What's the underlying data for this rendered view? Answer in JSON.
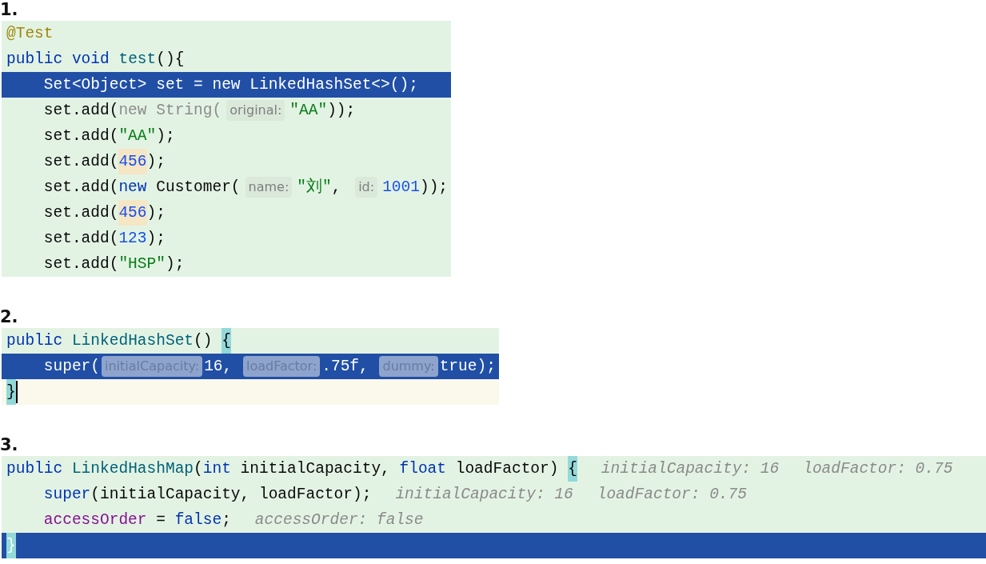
{
  "sections": [
    {
      "number": "1.",
      "lines": [
        {
          "selected": false,
          "caret": false,
          "indented": false,
          "tokens": [
            {
              "kind": "annotation",
              "text": "@Test"
            }
          ]
        },
        {
          "selected": false,
          "caret": false,
          "indented": false,
          "tokens": [
            {
              "kind": "keyword",
              "text": "public void "
            },
            {
              "kind": "method",
              "text": "test"
            },
            {
              "kind": "plain",
              "text": "(){"
            }
          ]
        },
        {
          "selected": true,
          "caret": false,
          "indented": true,
          "tokens": [
            {
              "kind": "plain",
              "text": "Set<Object> set = "
            },
            {
              "kind": "keyword",
              "text": "new"
            },
            {
              "kind": "plain",
              "text": " LinkedHashSet<>();"
            }
          ]
        },
        {
          "selected": false,
          "caret": false,
          "indented": true,
          "tokens": [
            {
              "kind": "plain",
              "text": "set.add("
            },
            {
              "kind": "muted",
              "text": "new String("
            },
            {
              "kind": "hint",
              "text": "original:"
            },
            {
              "kind": "string",
              "text": "\"AA\""
            },
            {
              "kind": "plain",
              "text": "));"
            }
          ]
        },
        {
          "selected": false,
          "caret": false,
          "indented": true,
          "tokens": [
            {
              "kind": "plain",
              "text": "set.add("
            },
            {
              "kind": "string",
              "text": "\"AA\""
            },
            {
              "kind": "plain",
              "text": ");"
            }
          ]
        },
        {
          "selected": false,
          "caret": false,
          "indented": true,
          "tokens": [
            {
              "kind": "plain",
              "text": "set.add("
            },
            {
              "kind": "occurrence",
              "text": "456"
            },
            {
              "kind": "plain",
              "text": ");"
            }
          ]
        },
        {
          "selected": false,
          "caret": false,
          "indented": true,
          "tokens": [
            {
              "kind": "plain",
              "text": "set.add("
            },
            {
              "kind": "keyword",
              "text": "new"
            },
            {
              "kind": "plain",
              "text": " Customer("
            },
            {
              "kind": "hint",
              "text": "name:"
            },
            {
              "kind": "string",
              "text": "\"刘\""
            },
            {
              "kind": "plain",
              "text": ", "
            },
            {
              "kind": "hint",
              "text": "id:"
            },
            {
              "kind": "number",
              "text": "1001"
            },
            {
              "kind": "plain",
              "text": "));"
            }
          ]
        },
        {
          "selected": false,
          "caret": false,
          "indented": true,
          "tokens": [
            {
              "kind": "plain",
              "text": "set.add("
            },
            {
              "kind": "occurrence",
              "text": "456"
            },
            {
              "kind": "plain",
              "text": ");"
            }
          ]
        },
        {
          "selected": false,
          "caret": false,
          "indented": true,
          "tokens": [
            {
              "kind": "plain",
              "text": "set.add("
            },
            {
              "kind": "number",
              "text": "123"
            },
            {
              "kind": "plain",
              "text": ");"
            }
          ]
        },
        {
          "selected": false,
          "caret": false,
          "indented": true,
          "tokens": [
            {
              "kind": "plain",
              "text": "set.add("
            },
            {
              "kind": "string",
              "text": "\"HSP\""
            },
            {
              "kind": "plain",
              "text": ");"
            }
          ]
        }
      ]
    },
    {
      "number": "2.",
      "lines": [
        {
          "selected": false,
          "caret": false,
          "indented": false,
          "tokens": [
            {
              "kind": "keyword",
              "text": "public "
            },
            {
              "kind": "method",
              "text": "LinkedHashSet"
            },
            {
              "kind": "plain",
              "text": "() "
            },
            {
              "kind": "match",
              "text": "{"
            }
          ]
        },
        {
          "selected": true,
          "caret": false,
          "indented": true,
          "tokens": [
            {
              "kind": "keyword",
              "text": "super"
            },
            {
              "kind": "plain",
              "text": "("
            },
            {
              "kind": "hint",
              "text": "initialCapacity:"
            },
            {
              "kind": "plain",
              "text": "16, "
            },
            {
              "kind": "hint",
              "text": "loadFactor:"
            },
            {
              "kind": "plain",
              "text": ".75f, "
            },
            {
              "kind": "hint",
              "text": "dummy:"
            },
            {
              "kind": "plain",
              "text": "true);"
            }
          ]
        },
        {
          "selected": false,
          "caret": true,
          "indented": false,
          "tokens": [
            {
              "kind": "match",
              "text": "}"
            }
          ]
        }
      ]
    },
    {
      "number": "3.",
      "lines": [
        {
          "selected": false,
          "caret": false,
          "indented": false,
          "tokens": [
            {
              "kind": "keyword",
              "text": "public "
            },
            {
              "kind": "method",
              "text": "LinkedHashMap"
            },
            {
              "kind": "plain",
              "text": "("
            },
            {
              "kind": "keyword",
              "text": "int"
            },
            {
              "kind": "plain",
              "text": " initialCapacity, "
            },
            {
              "kind": "keyword",
              "text": "float"
            },
            {
              "kind": "plain",
              "text": " loadFactor) "
            },
            {
              "kind": "match",
              "text": "{"
            },
            {
              "kind": "inlay",
              "text": "initialCapacity: 16"
            },
            {
              "kind": "inlay",
              "text": "loadFactor: 0.75"
            }
          ]
        },
        {
          "selected": false,
          "caret": false,
          "indented": true,
          "tokens": [
            {
              "kind": "keyword",
              "text": "super"
            },
            {
              "kind": "plain",
              "text": "(initialCapacity, loadFactor);"
            },
            {
              "kind": "inlay",
              "text": "initialCapacity: 16"
            },
            {
              "kind": "inlay",
              "text": "loadFactor: 0.75"
            }
          ]
        },
        {
          "selected": false,
          "caret": false,
          "indented": true,
          "tokens": [
            {
              "kind": "field",
              "text": "accessOrder"
            },
            {
              "kind": "plain",
              "text": " = "
            },
            {
              "kind": "keyword",
              "text": "false"
            },
            {
              "kind": "plain",
              "text": ";"
            },
            {
              "kind": "inlay",
              "text": "accessOrder: false"
            }
          ]
        },
        {
          "selected": true,
          "caret": false,
          "indented": false,
          "tokens": [
            {
              "kind": "match",
              "text": "}"
            }
          ]
        }
      ]
    }
  ]
}
